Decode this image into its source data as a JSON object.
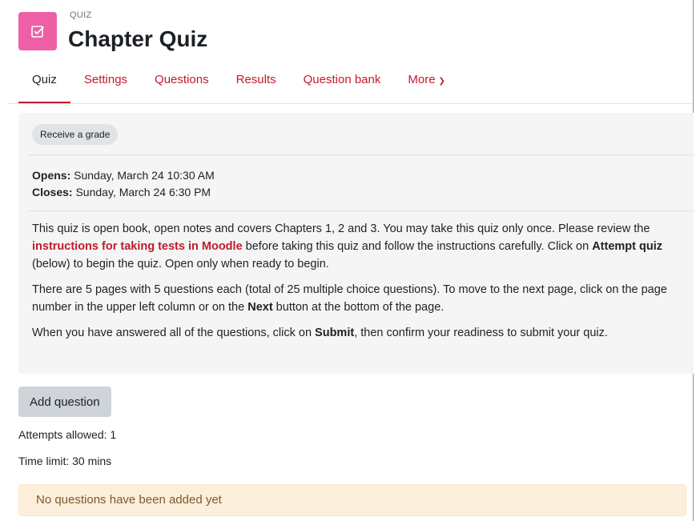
{
  "header": {
    "module_type": "QUIZ",
    "title": "Chapter Quiz",
    "icon": "quiz-checkbox-icon",
    "icon_color": "#ef5fa6"
  },
  "tabs": [
    {
      "label": "Quiz",
      "active": true
    },
    {
      "label": "Settings",
      "active": false
    },
    {
      "label": "Questions",
      "active": false
    },
    {
      "label": "Results",
      "active": false
    },
    {
      "label": "Question bank",
      "active": false
    },
    {
      "label": "More",
      "active": false
    }
  ],
  "info": {
    "completion_badge": "Receive a grade",
    "opens_label": "Opens:",
    "opens_value": " Sunday, March 24 10:30 AM",
    "closes_label": "Closes:",
    "closes_value": " Sunday, March 24 6:30 PM",
    "para1_a": "This quiz is open book, open notes and covers Chapters 1, 2 and 3. You may take this quiz only once. Please review the ",
    "para1_link": "instructions for taking tests in Moodle",
    "para1_b": " before taking this quiz and follow the instructions carefully. Click on ",
    "para1_bold": "Attempt quiz",
    "para1_c": " (below) to begin the quiz. Open only when ready to begin.",
    "para2_a": "There are 5 pages with 5 questions each (total of 25 multiple choice questions). To move to the next page, click on the page number in the upper left column or on the ",
    "para2_bold": "Next",
    "para2_b": " button at the bottom of the page.",
    "para3_a": "When you have answered all of the questions, click on ",
    "para3_bold": "Submit",
    "para3_b": ", then confirm your readiness to submit your quiz."
  },
  "actions": {
    "add_question": "Add question"
  },
  "details": {
    "attempts": "Attempts allowed: 1",
    "time_limit": "Time limit: 30 mins"
  },
  "notice": "No questions have been added yet",
  "colors": {
    "accent": "#c31a2b",
    "info_bg": "#f5f5f6",
    "notice_bg": "#fcefdc"
  }
}
